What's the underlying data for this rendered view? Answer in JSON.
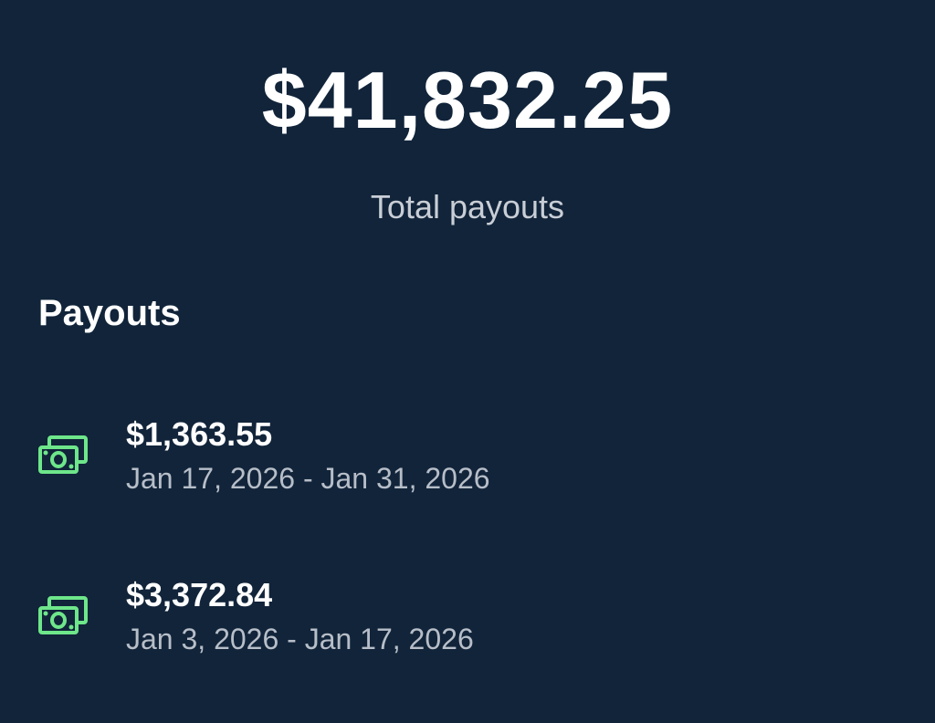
{
  "summary": {
    "total_amount": "$41,832.25",
    "total_label": "Total payouts"
  },
  "payouts_section": {
    "title": "Payouts",
    "items": [
      {
        "amount": "$1,363.55",
        "date_range": "Jan 17, 2026 - Jan 31, 2026",
        "icon": "money-icon"
      },
      {
        "amount": "$3,372.84",
        "date_range": "Jan 3, 2026 - Jan 17, 2026",
        "icon": "money-icon"
      }
    ]
  },
  "colors": {
    "background": "#11243a",
    "primary_text": "#ffffff",
    "secondary_text": "#b7bec8",
    "icon_green": "#6ee68a"
  }
}
